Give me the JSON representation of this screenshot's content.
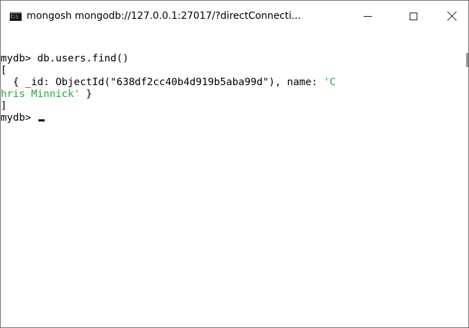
{
  "window": {
    "title": "mongosh mongodb://127.0.0.1:27017/?directConnecti...",
    "app_icon": "console-icon",
    "app_icon_text": "C:\\",
    "controls": {
      "minimize": "minimize-icon",
      "maximize": "maximize-icon",
      "close": "close-icon"
    }
  },
  "terminal": {
    "lines": [
      {
        "prompt": "mydb> ",
        "text": "db.users.find()"
      },
      {
        "text": "["
      },
      {
        "text": "  { _id: ObjectId(\"638df2cc40b4d919b5aba99d\"), name: ",
        "string": "'C"
      },
      {
        "string": "hris Minnick'",
        "text_after": " }"
      },
      {
        "text": "]"
      },
      {
        "prompt": "mydb> ",
        "cursor": true
      }
    ]
  },
  "colors": {
    "background": "#ffffff",
    "text": "#000000",
    "string": "#2aa43c"
  }
}
